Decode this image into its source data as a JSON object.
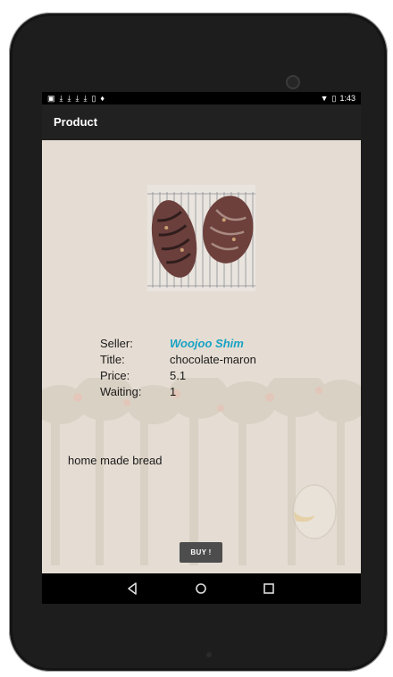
{
  "status_bar": {
    "left_icons": [
      "image-icon",
      "download-icon",
      "download-icon",
      "download-icon",
      "download-icon",
      "phone-icon",
      "notification-icon"
    ],
    "time": "1:43"
  },
  "action_bar": {
    "title": "Product"
  },
  "product": {
    "image_alt": "bread",
    "fields": [
      {
        "label": "Seller:",
        "value": "Woojoo Shim"
      },
      {
        "label": "Title:",
        "value": "chocolate-maron"
      },
      {
        "label": "Price:",
        "value": "5.1"
      },
      {
        "label": "Waiting:",
        "value": "1"
      }
    ],
    "description": "home made bread",
    "buy_label": "BUY !"
  },
  "colors": {
    "screen_bg": "#e5ddd3",
    "seller_link": "#19a2c4",
    "action_bar": "#212121",
    "buy_button": "#4d4d4d"
  },
  "nav_icons": [
    "back-icon",
    "home-icon",
    "recents-icon"
  ]
}
